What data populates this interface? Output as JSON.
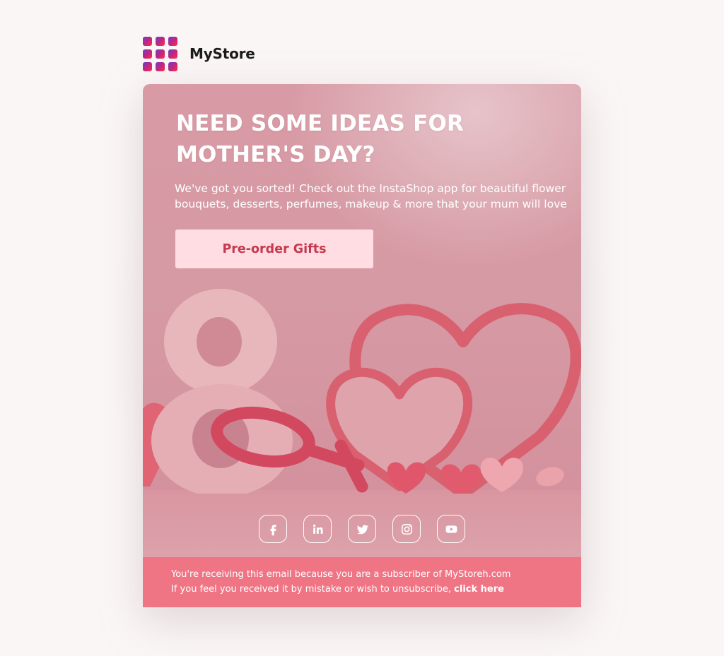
{
  "brand": {
    "name": "MyStore",
    "logo_icon": "grid-logo-icon",
    "logo_colors": [
      "#6a3dc9",
      "#c8247a",
      "#ff2e4a"
    ]
  },
  "hero": {
    "headline_line1": "NEED SOME IDEAS FOR",
    "headline_line2": "MOTHER'S DAY?",
    "intro_line1": "We've got you sorted! Check out the InstaShop app for beautiful flower",
    "intro_line2": "bouquets, desserts, perfumes, makeup & more that your mum will love",
    "cta_label": "Pre-order Gifts",
    "image_subject": "pink 3D number eight, female symbol and hearts",
    "colors": {
      "background": "#d69aa4",
      "button": "#ffdde3",
      "button_text": "#c4394e"
    }
  },
  "social": [
    {
      "icon": "facebook-icon"
    },
    {
      "icon": "linkedin-icon"
    },
    {
      "icon": "twitter-icon"
    },
    {
      "icon": "instagram-icon"
    },
    {
      "icon": "youtube-icon"
    }
  ],
  "footer": {
    "line1": "You're receiving this email because you are a subscriber of MyStoreh.com",
    "line2_prefix": "If you feel you received it by mistake or wish to unsubscribe, ",
    "unsubscribe_link": "click here",
    "background": "#ef7585"
  }
}
